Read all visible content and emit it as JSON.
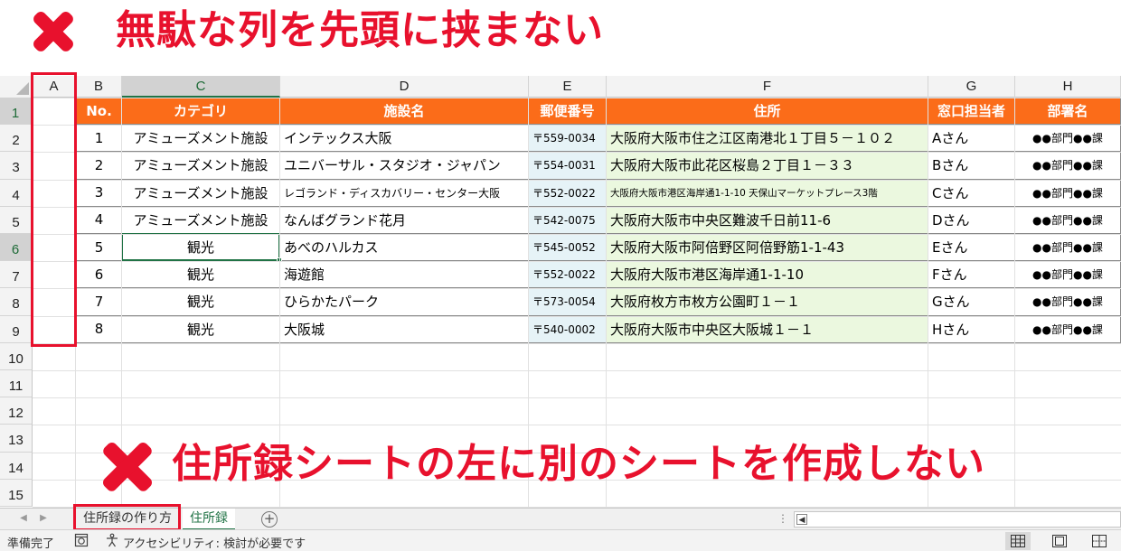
{
  "annotations": {
    "top_text": "無駄な列を先頭に挟まない",
    "bottom_text": "住所録シートの左に別のシートを作成しない",
    "mark_color": "#e8112d"
  },
  "columns": [
    "A",
    "B",
    "C",
    "D",
    "E",
    "F",
    "G",
    "H"
  ],
  "rows": [
    "1",
    "2",
    "3",
    "4",
    "5",
    "6",
    "7",
    "8",
    "9",
    "10",
    "11",
    "12",
    "13",
    "14",
    "15"
  ],
  "active_cell": "C6",
  "header_color": "#fb6c19",
  "table_header": [
    "No.",
    "カテゴリ",
    "施設名",
    "郵便番号",
    "住所",
    "窓口担当者",
    "部署名"
  ],
  "table_rows": [
    [
      "1",
      "アミューズメント施設",
      " インテックス大阪",
      "〒559-0034",
      "大阪府大阪市住之江区南港北１丁目５－１０２",
      "Aさん",
      "●●部門●●課"
    ],
    [
      "2",
      "アミューズメント施設",
      "ユニバーサル・スタジオ・ジャパン",
      "〒554-0031",
      "大阪府大阪市此花区桜島２丁目１－３３",
      "Bさん",
      "●●部門●●課"
    ],
    [
      "3",
      "アミューズメント施設",
      "レゴランド・ディスカバリー・センター大阪",
      "〒552-0022",
      "大阪府大阪市港区海岸通1-1-10 天保山マーケットプレース3階",
      "Cさん",
      "●●部門●●課"
    ],
    [
      "4",
      "アミューズメント施設",
      "なんばグランド花月",
      "〒542-0075",
      "大阪府大阪市中央区難波千日前11-6",
      "Dさん",
      "●●部門●●課"
    ],
    [
      "5",
      "観光",
      "あべのハルカス",
      "〒545-0052",
      "大阪府大阪市阿倍野区阿倍野筋1-1-43",
      "Eさん",
      "●●部門●●課"
    ],
    [
      "6",
      "観光",
      "海遊館",
      "〒552-0022",
      "大阪府大阪市港区海岸通1-1-10",
      "Fさん",
      "●●部門●●課"
    ],
    [
      "7",
      "観光",
      "ひらかたパーク",
      "〒573-0054",
      "大阪府枚方市枚方公園町１－１",
      "Gさん",
      "●●部門●●課"
    ],
    [
      "8",
      "観光",
      "大阪城",
      "〒540-0002",
      "大阪府大阪市中央区大阪城１－１",
      "Hさん",
      "●●部門●●課"
    ]
  ],
  "sheet_tabs": [
    {
      "label": "住所録の作り方",
      "active": false
    },
    {
      "label": "住所録",
      "active": true
    }
  ],
  "add_sheet_label": "+",
  "status": {
    "ready": "準備完了",
    "accessibility": "アクセシビリティ: 検討が必要です"
  },
  "icons": {
    "macro": "macro-record-icon",
    "accessibility": "accessibility-icon",
    "view_normal": "normal-view-icon",
    "view_page_layout": "page-layout-icon",
    "view_page_break": "page-break-icon"
  }
}
